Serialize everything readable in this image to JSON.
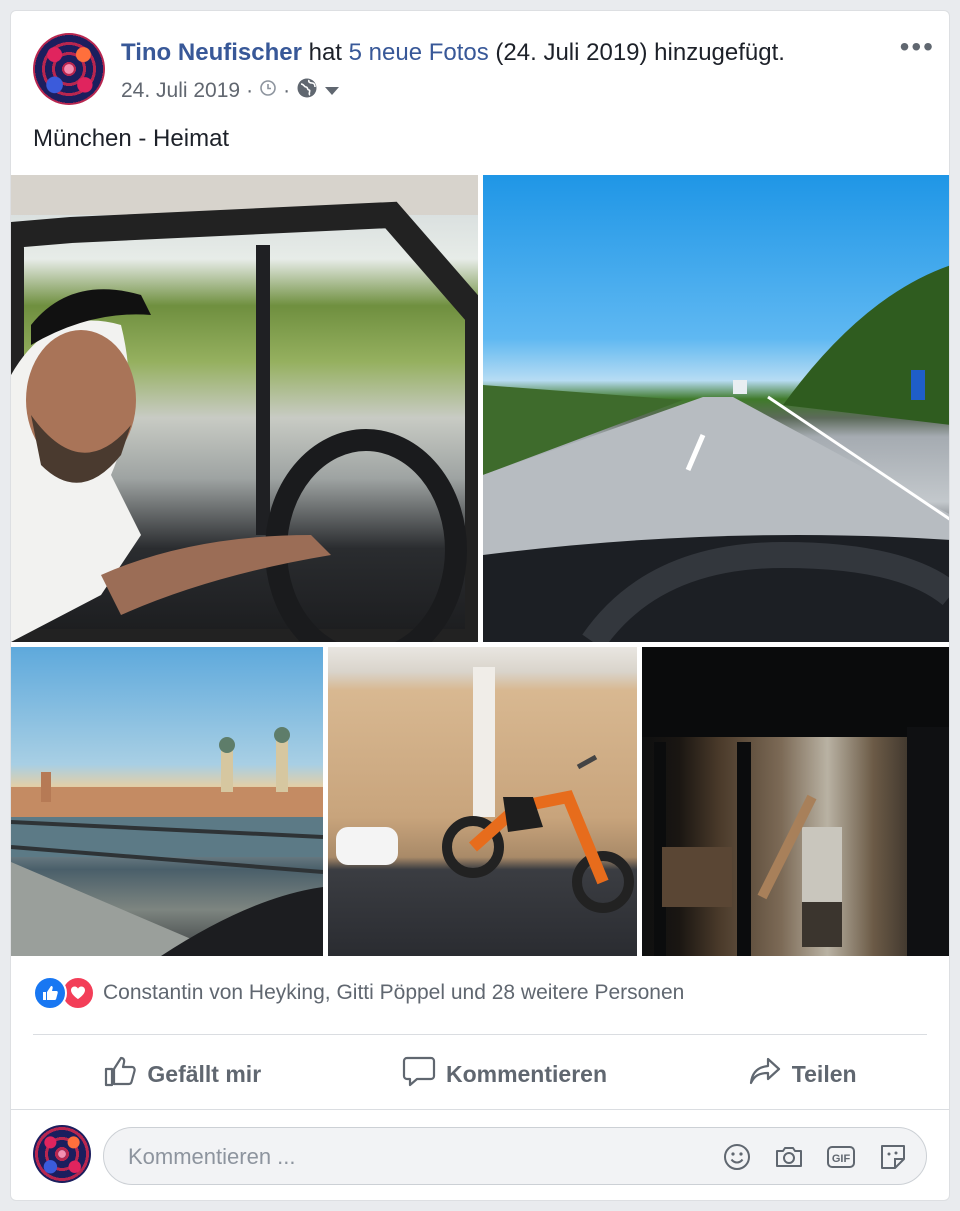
{
  "post": {
    "author": "Tino Neufischer",
    "verb_before": " hat ",
    "photos_link": "5 neue Fotos",
    "verb_after": " (24. Juli 2019) hinzugefügt.",
    "date": "24. Juli 2019",
    "separator": "·",
    "more_label": "•••",
    "caption": "München - Heimat",
    "photo_count": 5
  },
  "reactions": {
    "types": [
      "like-icon",
      "love-icon"
    ],
    "text": "Constantin von Heyking, Gitti Pöppel und 28 weitere Personen"
  },
  "actions": {
    "like_label": "Gefällt mir",
    "comment_label": "Kommentieren",
    "share_label": "Teilen"
  },
  "comment": {
    "placeholder": "Kommentieren ...",
    "icons": [
      "emoji-icon",
      "camera-icon",
      "gif-icon",
      "sticker-icon"
    ]
  },
  "colors": {
    "link": "#385898",
    "like": "#1877f2",
    "love": "#f33e58",
    "muted": "#606770"
  }
}
